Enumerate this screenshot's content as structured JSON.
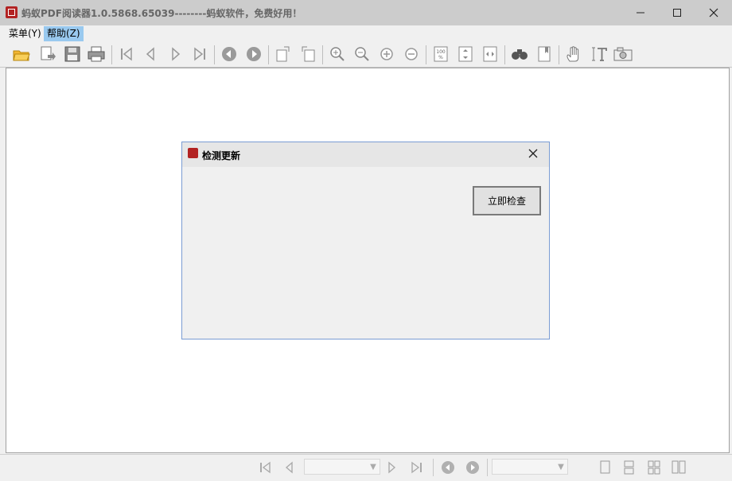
{
  "window": {
    "title": "蚂蚁PDF阅读器1.0.5868.65039--------蚂蚁软件，免费好用！",
    "minimize": "—",
    "maximize": "☐",
    "close": "✕"
  },
  "menu": {
    "items": [
      {
        "label": "菜单(Y)"
      },
      {
        "label": "帮助(Z)"
      }
    ]
  },
  "toolbar": {
    "icons": [
      "open-folder-icon",
      "export-icon",
      "save-icon",
      "print-icon",
      "first-page-icon",
      "prev-page-icon",
      "next-page-icon",
      "last-page-icon",
      "back-icon",
      "forward-icon",
      "rotate-left-icon",
      "rotate-right-icon",
      "zoom-in-icon",
      "zoom-out-icon",
      "zoom-plus-icon",
      "zoom-minus-icon",
      "actual-size-icon",
      "fit-page-icon",
      "fit-width-icon",
      "find-icon",
      "bookmark-icon",
      "hand-tool-icon",
      "text-select-icon",
      "snapshot-icon"
    ]
  },
  "dialog": {
    "title": "检测更新",
    "close": "✕",
    "check_button": "立即检查"
  },
  "statusbar": {
    "page_value": "",
    "zoom_value": ""
  },
  "colors": {
    "titlebar": "#cccccc",
    "menu_active": "#99c9ef",
    "app_icon": "#b22222",
    "dialog_border": "#7a9cd3"
  }
}
